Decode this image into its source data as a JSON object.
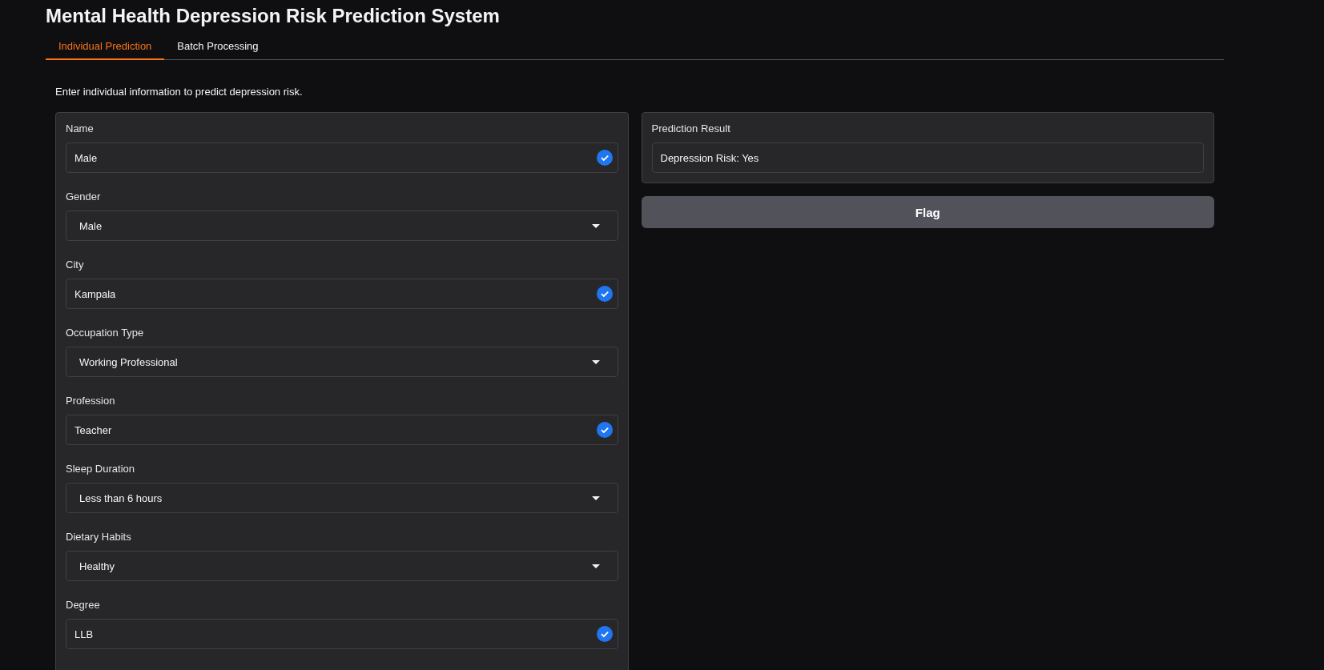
{
  "title": "Mental Health Depression Risk Prediction System",
  "tabs": [
    {
      "label": "Individual Prediction",
      "selected": true
    },
    {
      "label": "Batch Processing",
      "selected": false
    }
  ],
  "description": "Enter individual information to predict depression risk.",
  "form": {
    "fields": [
      {
        "label": "Name",
        "kind": "combobox",
        "value": "Male"
      },
      {
        "label": "Gender",
        "kind": "dropdown",
        "value": "Male"
      },
      {
        "label": "City",
        "kind": "combobox",
        "value": "Kampala"
      },
      {
        "label": "Occupation Type",
        "kind": "dropdown",
        "value": "Working Professional"
      },
      {
        "label": "Profession",
        "kind": "combobox",
        "value": "Teacher"
      },
      {
        "label": "Sleep Duration",
        "kind": "dropdown",
        "value": "Less than 6 hours"
      },
      {
        "label": "Dietary Habits",
        "kind": "dropdown",
        "value": "Healthy"
      },
      {
        "label": "Degree",
        "kind": "combobox",
        "value": "LLB"
      }
    ]
  },
  "result": {
    "label": "Prediction Result",
    "value": "Depression Risk: Yes"
  },
  "flag_button": "Flag"
}
